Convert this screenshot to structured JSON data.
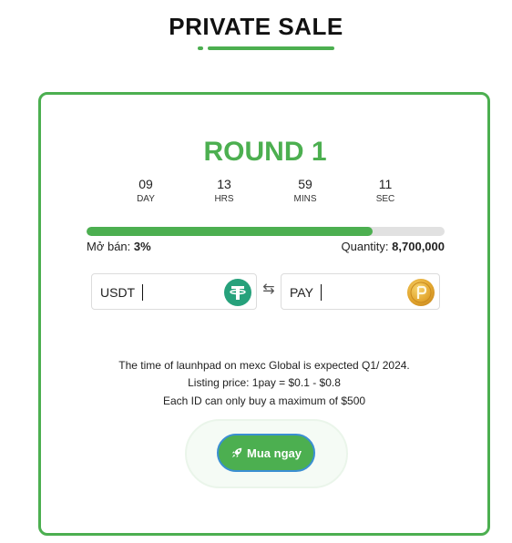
{
  "header": {
    "title": "PRIVATE SALE"
  },
  "round": {
    "title": "ROUND 1"
  },
  "countdown": [
    {
      "value": "09",
      "label": "DAY"
    },
    {
      "value": "13",
      "label": "HRS"
    },
    {
      "value": "59",
      "label": "MINS"
    },
    {
      "value": "11",
      "label": "SEC"
    }
  ],
  "progress": {
    "fill_fraction": 0.8
  },
  "stats": {
    "sold_label": "Mở bán:",
    "sold_value": "3%",
    "quantity_label": "Quantity:",
    "quantity_value": "8,700,000"
  },
  "exchange": {
    "from_currency": "USDT",
    "from_value": "",
    "to_currency": "PAY",
    "to_value": "",
    "from_icon": "tether-icon",
    "to_icon": "pay-coin-icon",
    "swap_icon": "swap-arrows-icon"
  },
  "info": {
    "line1": "The time of launhpad on mexc Global is expected Q1/ 2024.",
    "line2": "Listing price: 1pay = $0.1 - $0.8",
    "line3": "Each ID can only buy a maximum of $500"
  },
  "buy_button": {
    "label": "Mua ngay",
    "icon": "rocket-icon"
  },
  "colors": {
    "accent": "#4caf50",
    "button_border": "#3b8fd2",
    "tether": "#26a17b",
    "pay_coin": "#e2a52d"
  }
}
